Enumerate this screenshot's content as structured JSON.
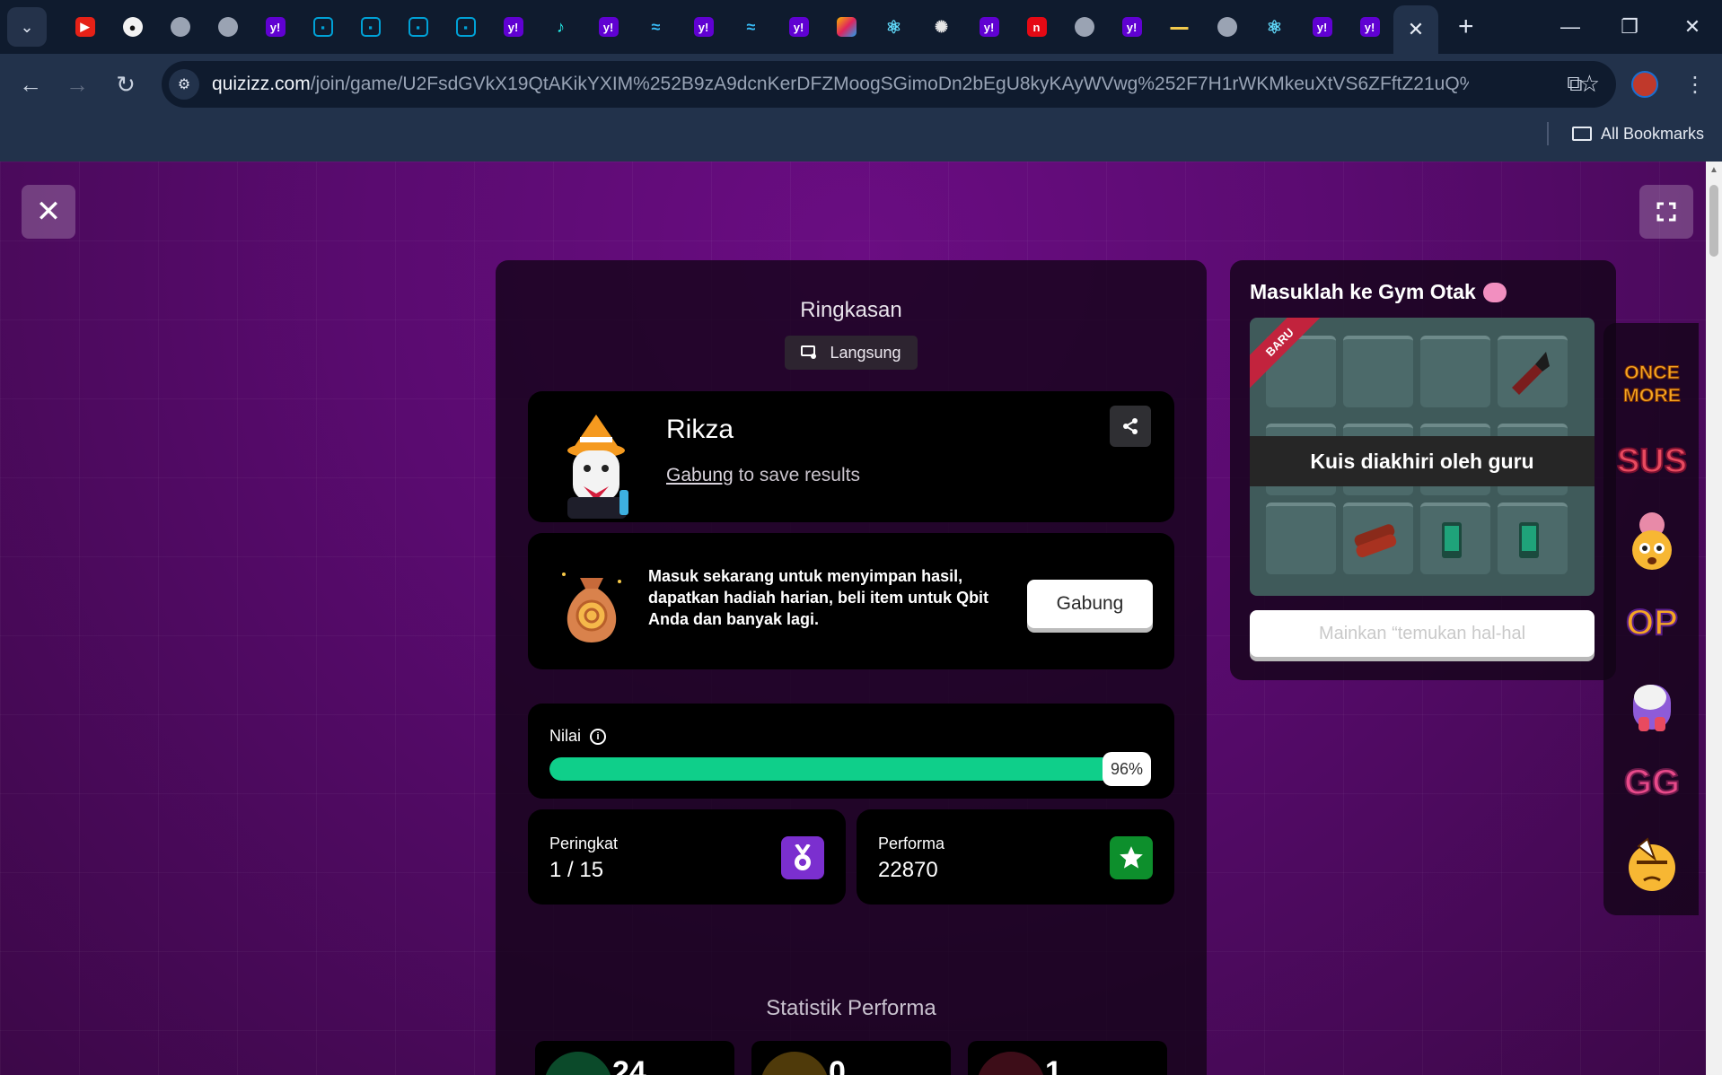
{
  "browser": {
    "tab_icons": [
      "youtube-icon",
      "github-icon",
      "globe-icon",
      "globe-icon",
      "yahoo-icon",
      "bilibili-icon",
      "bilibili-icon",
      "bilibili-icon",
      "bilibili-icon",
      "yahoo-icon",
      "tiktok-icon",
      "yahoo-icon",
      "tailwind-icon",
      "yahoo-icon",
      "tailwind-icon",
      "yahoo-icon",
      "colorful-icon",
      "react-icon",
      "openai-icon",
      "yahoo-icon",
      "netflix-icon",
      "globe-icon",
      "yahoo-icon",
      "banner-icon",
      "globe-icon",
      "react-icon",
      "yahoo-icon",
      "yahoo-icon"
    ],
    "url_host": "quizizz.com",
    "url_path": "/join/game/U2FsdGVkX19QtAKikYXIM%252B9zA9dcnKerDFZMoogSGimoDn2bEgU8kyKAyWVwg%252F7H1rWKMkeuXtVS6ZFftZ21uQ%25...",
    "bookmarks_label": "All Bookmarks"
  },
  "summary": {
    "title": "Ringkasan",
    "mode_label": "Langsung"
  },
  "player": {
    "name": "Rikza",
    "join_link": "Gabung",
    "join_suffix": "to save results"
  },
  "promo": {
    "text": "Masuk sekarang untuk menyimpan hasil, dapatkan hadiah harian, beli item untuk Qbit Anda dan banyak lagi.",
    "button": "Gabung"
  },
  "score": {
    "label": "Nilai",
    "percent_value": 96,
    "percent_text": "96%"
  },
  "stats": {
    "rank_label": "Peringkat",
    "rank_value": "1 / 15",
    "performance_label": "Performa",
    "performance_value": "22870"
  },
  "performance_stats": {
    "title": "Statistik Performa",
    "values": [
      "24",
      "0",
      "1"
    ]
  },
  "side_panel": {
    "title": "Masuklah ke Gym Otak",
    "badge": "BARU",
    "overlay": "Kuis diakhiri oleh guru",
    "play_button": "Mainkan “temukan hal-hal"
  },
  "stickers": [
    {
      "name": "once-more-sticker",
      "text": "ONCE MORE"
    },
    {
      "name": "sus-sticker",
      "text": "SUS"
    },
    {
      "name": "mind-blown-sticker",
      "text": ""
    },
    {
      "name": "op-sticker",
      "text": "OP"
    },
    {
      "name": "astronaut-sticker",
      "text": ""
    },
    {
      "name": "gg-sticker",
      "text": "GG"
    },
    {
      "name": "salute-sticker",
      "text": ""
    }
  ],
  "colors": {
    "accent_green": "#0fcf8a",
    "rank_purple": "#7b2fcf",
    "perf_green": "#0d8f2c",
    "page_purple": "#5a0b70"
  }
}
